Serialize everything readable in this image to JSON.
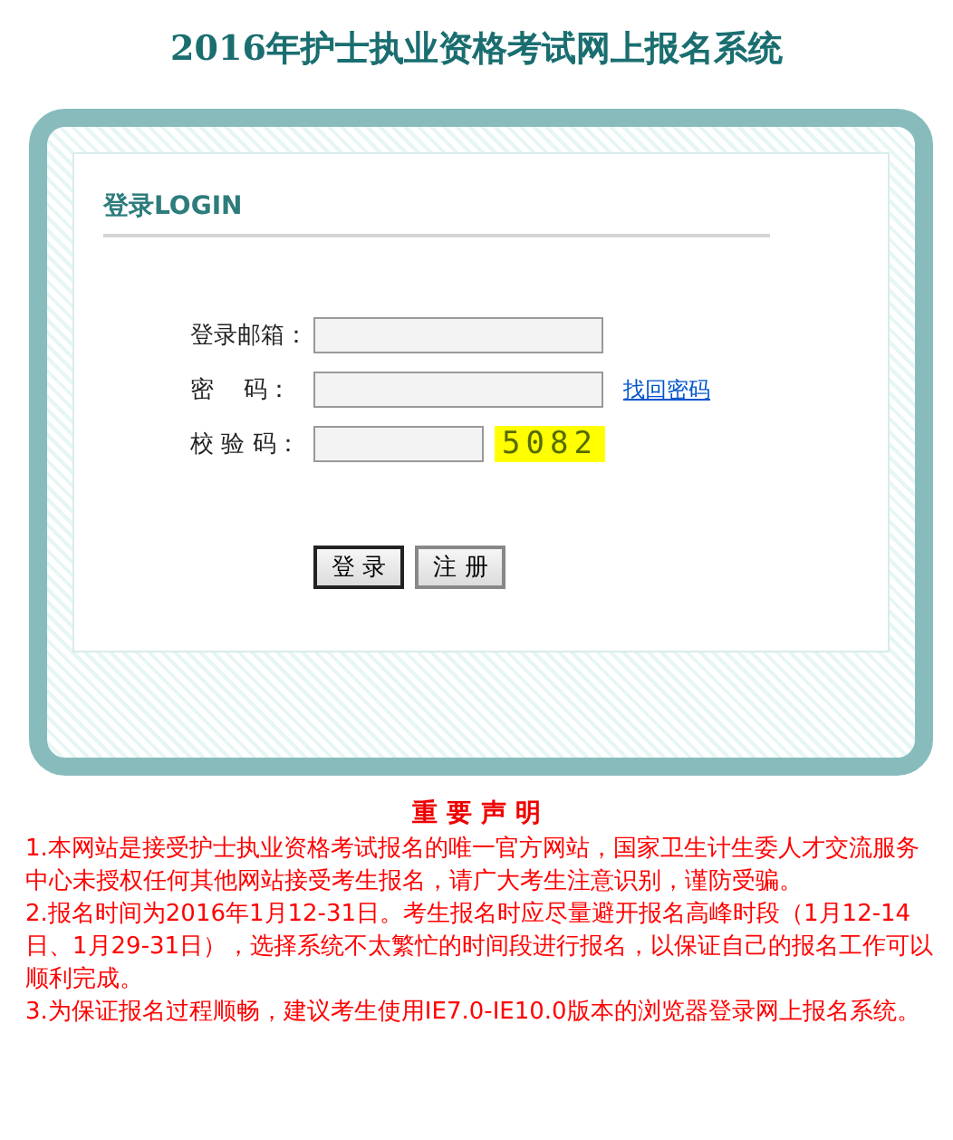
{
  "title": "2016年护士执业资格考试网上报名系统",
  "login": {
    "heading": "登录LOGIN",
    "fields": [
      {
        "label": "登录邮箱：",
        "kind": "text"
      },
      {
        "label": "密    码：",
        "kind": "password",
        "link": "找回密码"
      },
      {
        "label": "校 验 码：",
        "kind": "captcha",
        "captcha": "5082"
      }
    ],
    "buttons": [
      {
        "label": "登 录",
        "selected": true
      },
      {
        "label": "注 册",
        "selected": false
      }
    ]
  },
  "notice": {
    "heading": "重 要 声 明",
    "items": [
      "1.本网站是接受护士执业资格考试报名的唯一官方网站，国家卫生计生委人才交流服务中心未授权任何其他网站接受考生报名，请广大考生注意识别，谨防受骗。",
      "2.报名时间为2016年1月12-31日。考生报名时应尽量避开报名高峰时段（1月12-14日、1月29-31日），选择系统不太繁忙的时间段进行报名，以保证自己的报名工作可以顺利完成。",
      "3.为保证报名过程顺畅，建议考生使用IE7.0-IE10.0版本的浏览器登录网上报名系统。"
    ]
  }
}
